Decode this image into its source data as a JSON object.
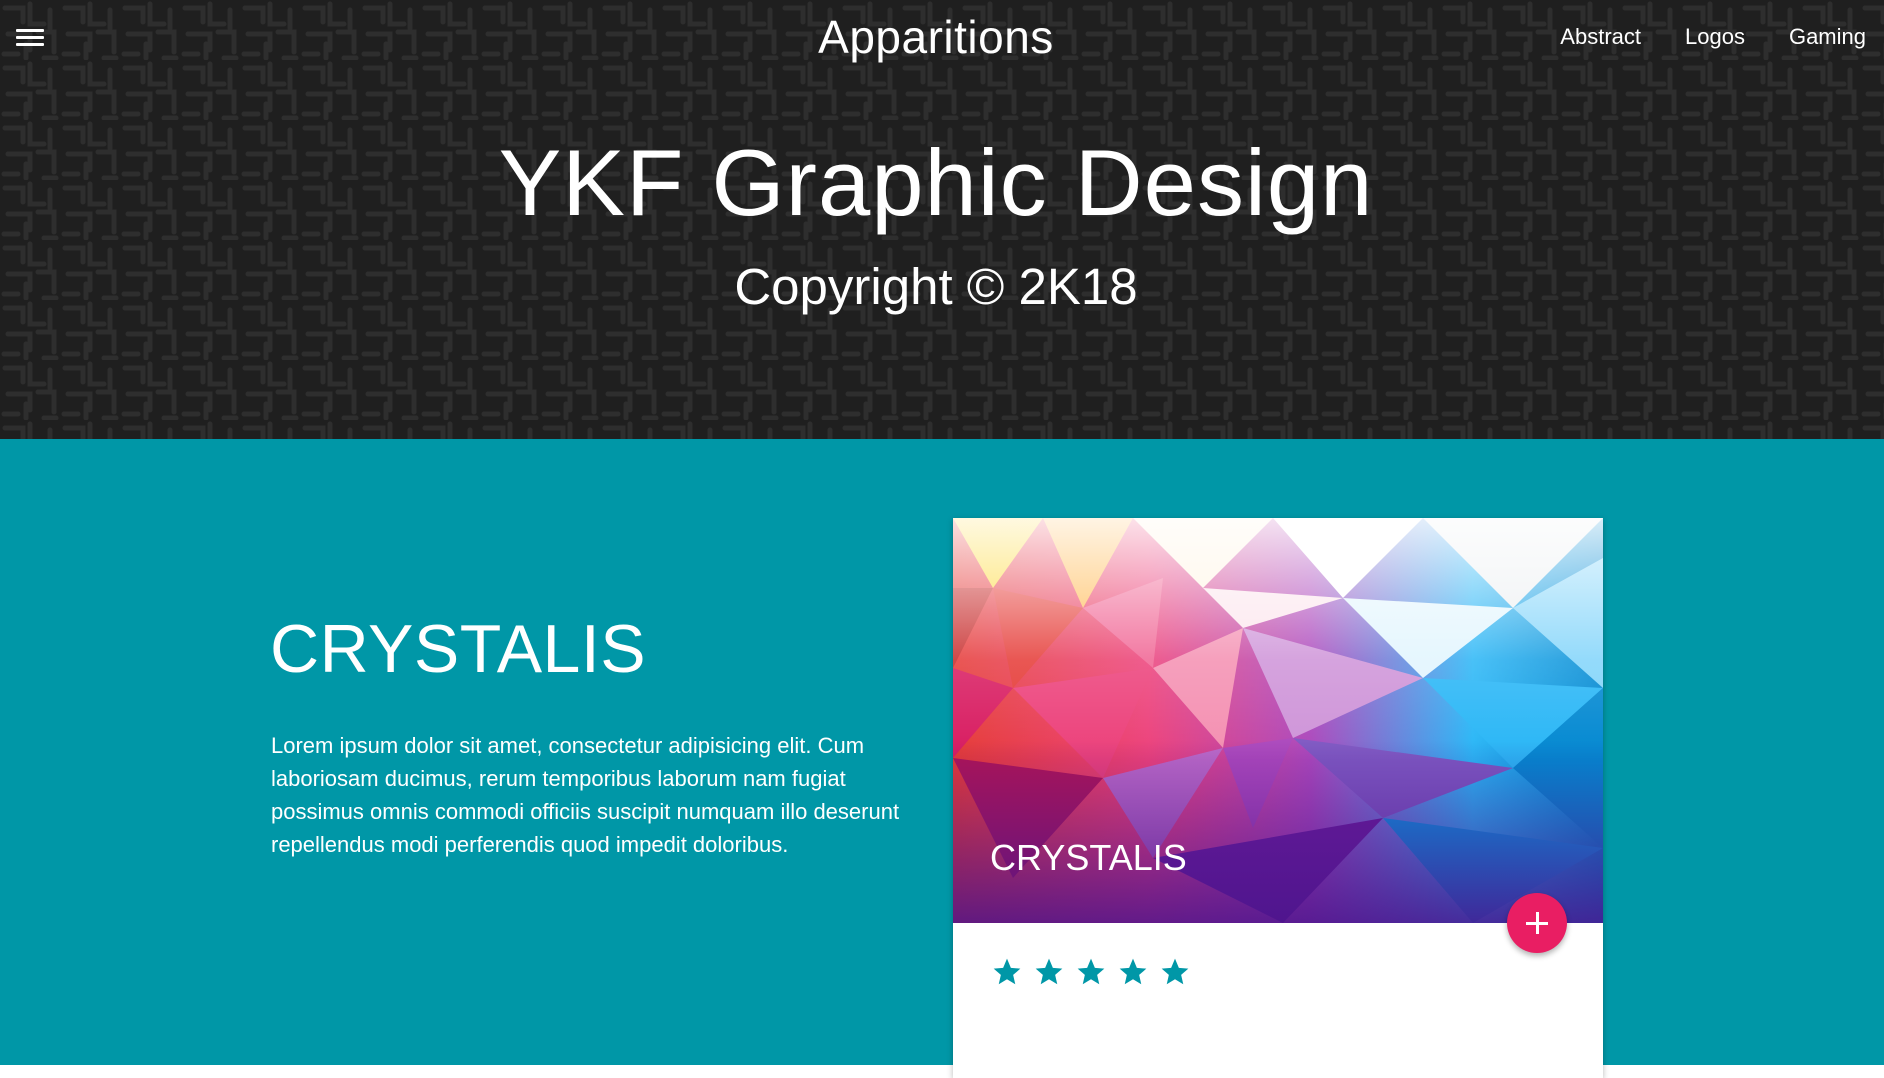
{
  "header": {
    "brand": "Apparitions",
    "menu_icon": "hamburger-menu-icon",
    "nav": [
      {
        "label": "Abstract"
      },
      {
        "label": "Logos"
      },
      {
        "label": "Gaming"
      }
    ],
    "title": "YKF Graphic Design",
    "subtitle": "Copyright © 2K18",
    "background_color": "#1f1f1f"
  },
  "section": {
    "background_color": "#0097a7",
    "title": "CRYSTALIS",
    "text": "Lorem ipsum dolor sit amet, consectetur adipisicing elit. Cum laboriosam ducimus, rerum temporibus laborum nam fugiat possimus omnis commodi officiis suscipit numquam illo deserunt repellendus modi perferendis quod impedit doloribus."
  },
  "card": {
    "caption": "CRYSTALIS",
    "fab_icon": "plus-icon",
    "fab_color": "#e91e63",
    "star_icon": "star-icon",
    "rating": 5,
    "rating_max": 5
  }
}
